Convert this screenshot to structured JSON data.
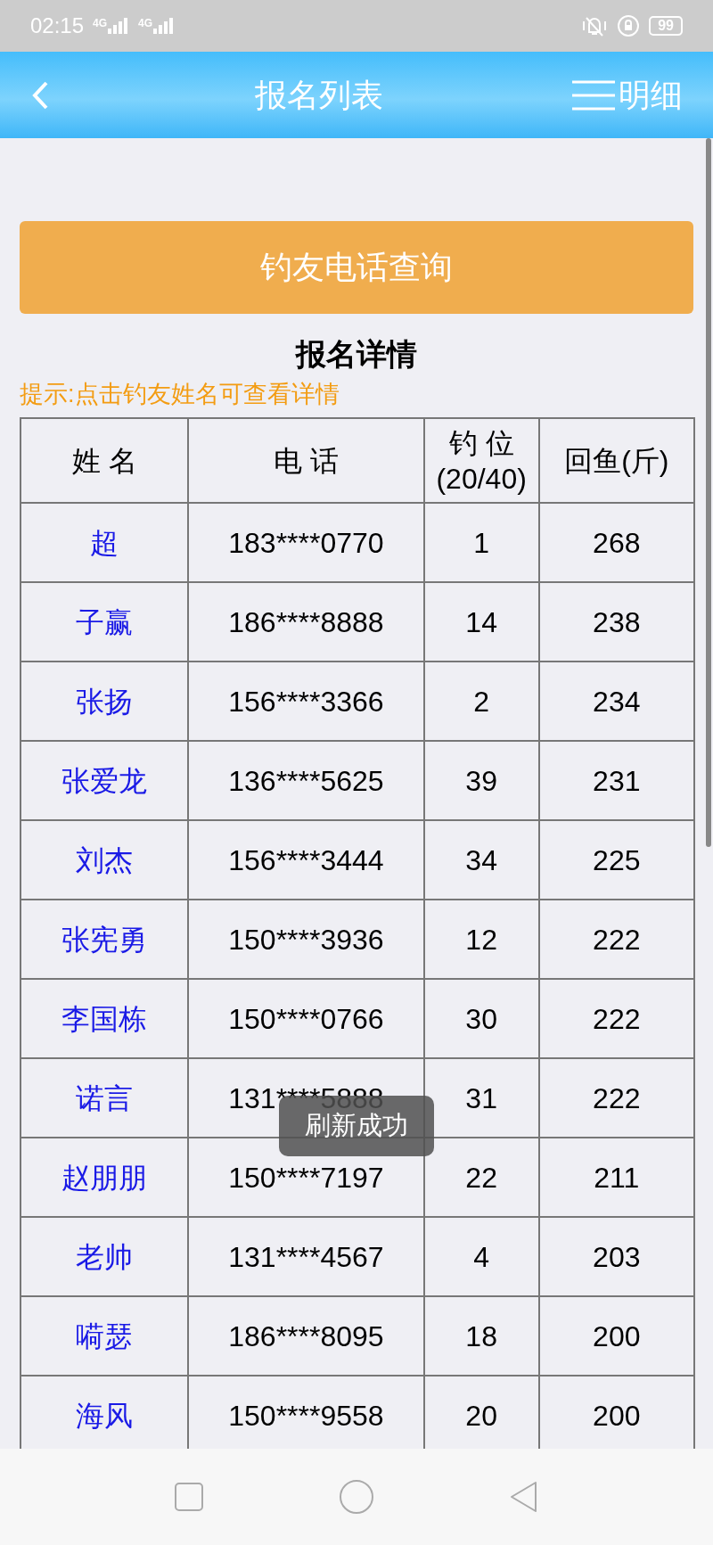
{
  "status_bar": {
    "time": "02:15",
    "network_1": "4G",
    "network_2": "4G",
    "battery": "99"
  },
  "header": {
    "title": "报名列表",
    "menu_label": "明细"
  },
  "query_button": "钓友电话查询",
  "section_title": "报名详情",
  "hint": "提示:点击钓友姓名可查看详情",
  "table": {
    "columns": [
      "姓 名",
      "电 话",
      "钓 位\n(20/40)",
      "回鱼(斤)"
    ],
    "rows": [
      {
        "name": "超",
        "phone": "183****0770",
        "spot": "1",
        "fish": "268"
      },
      {
        "name": "子赢",
        "phone": "186****8888",
        "spot": "14",
        "fish": "238"
      },
      {
        "name": "张扬",
        "phone": "156****3366",
        "spot": "2",
        "fish": "234"
      },
      {
        "name": "张爱龙",
        "phone": "136****5625",
        "spot": "39",
        "fish": "231"
      },
      {
        "name": "刘杰",
        "phone": "156****3444",
        "spot": "34",
        "fish": "225"
      },
      {
        "name": "张宪勇",
        "phone": "150****3936",
        "spot": "12",
        "fish": "222"
      },
      {
        "name": "李国栋",
        "phone": "150****0766",
        "spot": "30",
        "fish": "222"
      },
      {
        "name": "诺言",
        "phone": "131****5888",
        "spot": "31",
        "fish": "222"
      },
      {
        "name": "赵朋朋",
        "phone": "150****7197",
        "spot": "22",
        "fish": "211"
      },
      {
        "name": "老帅",
        "phone": "131****4567",
        "spot": "4",
        "fish": "203"
      },
      {
        "name": "嗬瑟",
        "phone": "186****8095",
        "spot": "18",
        "fish": "200"
      },
      {
        "name": "海风",
        "phone": "150****9558",
        "spot": "20",
        "fish": "200"
      }
    ]
  },
  "toast": "刷新成功"
}
